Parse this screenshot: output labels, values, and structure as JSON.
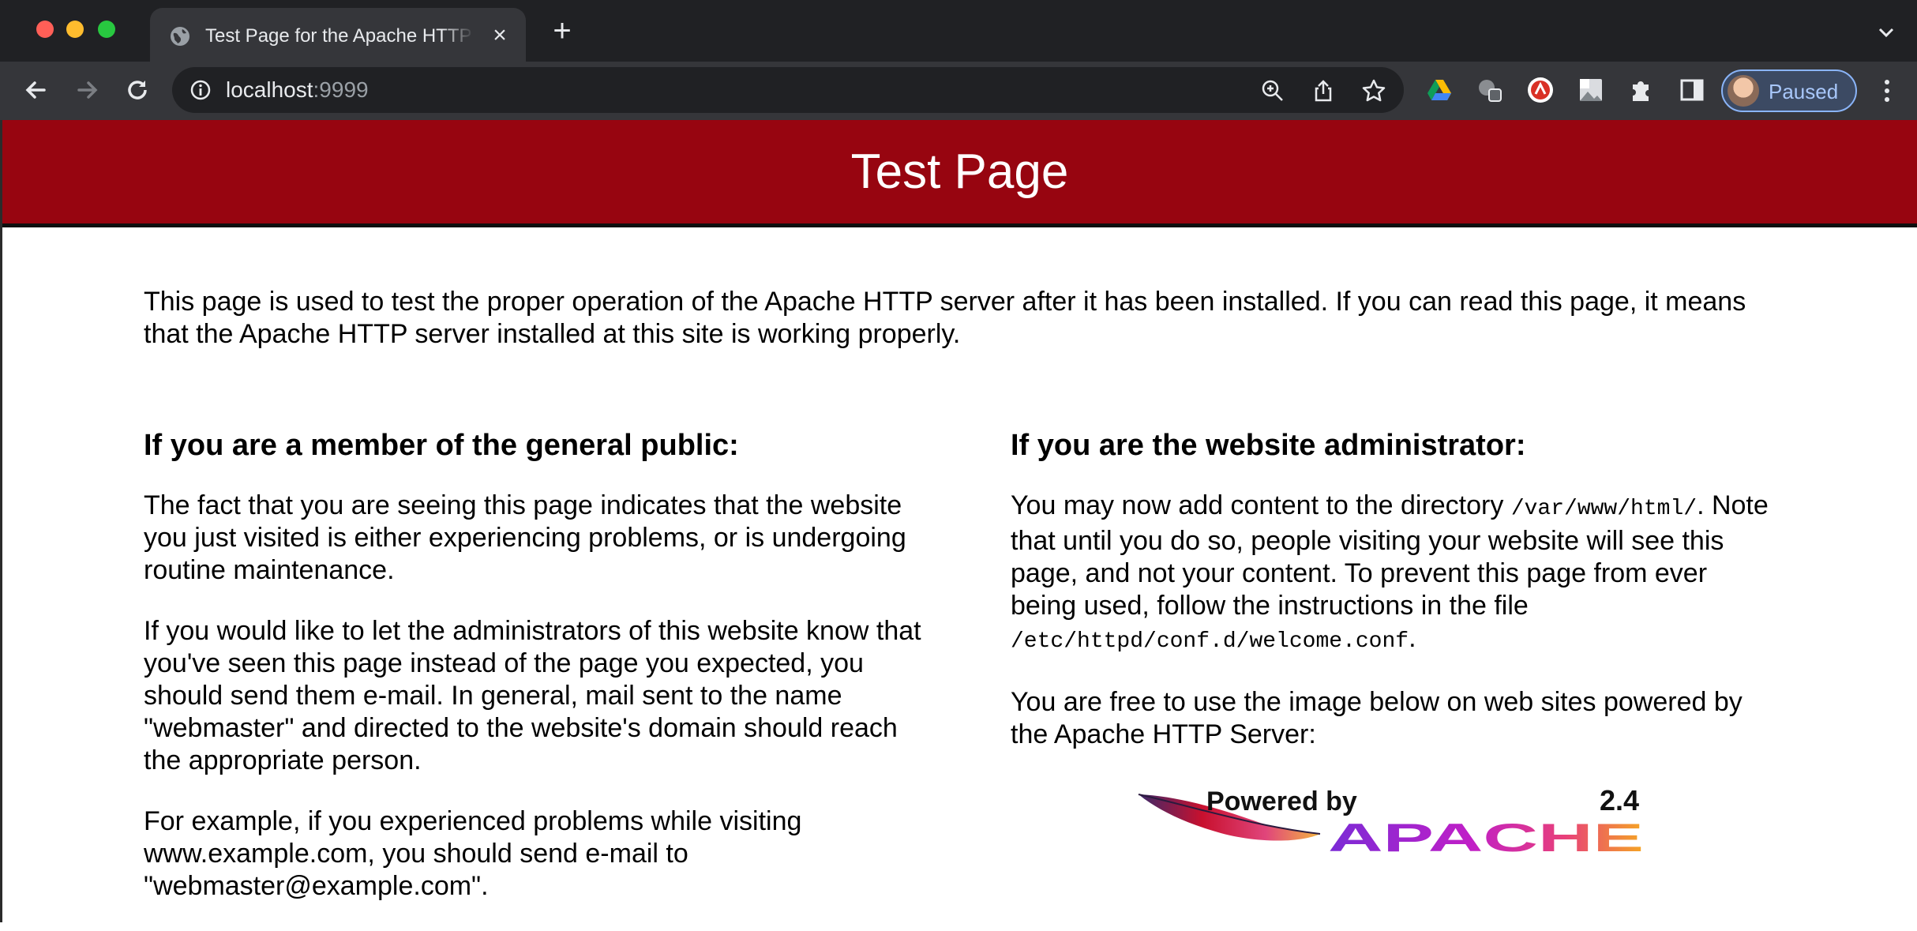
{
  "browser": {
    "tab": {
      "title": "Test Page for the Apache HTTP Server"
    },
    "address": {
      "host": "localhost",
      "port": ":9999"
    },
    "profile": {
      "label": "Paused"
    }
  },
  "page": {
    "banner_title": "Test Page",
    "intro": "This page is used to test the proper operation of the Apache HTTP server after it has been installed. If you can read this page, it means that the Apache HTTP server installed at this site is working properly.",
    "public": {
      "heading": "If you are a member of the general public:",
      "p1": "The fact that you are seeing this page indicates that the website you just visited is either experiencing problems, or is undergoing routine maintenance.",
      "p2": "If you would like to let the administrators of this website know that you've seen this page instead of the page you expected, you should send them e-mail. In general, mail sent to the name \"webmaster\" and directed to the website's domain should reach the appropriate person.",
      "p3": "For example, if you experienced problems while visiting www.example.com, you should send e-mail to \"webmaster@example.com\"."
    },
    "admin": {
      "heading": "If you are the website administrator:",
      "p1_a": "You may now add content to the directory ",
      "p1_dir": "/var/www/html/",
      "p1_b": ". Note that until you do so, people visiting your website will see this page, and not your content. To prevent this page from ever being used, follow the instructions in the file ",
      "p1_file": "/etc/httpd/conf.d/welcome.conf",
      "p1_c": ".",
      "p2": "You are free to use the image below on web sites powered by the Apache HTTP Server:"
    },
    "logo": {
      "powered_by": "Powered by",
      "version": "2.4",
      "apache": "APACHE"
    }
  },
  "colors": {
    "banner": "#970510",
    "chrome_dark": "#202124",
    "chrome_toolbar": "#35363a"
  }
}
